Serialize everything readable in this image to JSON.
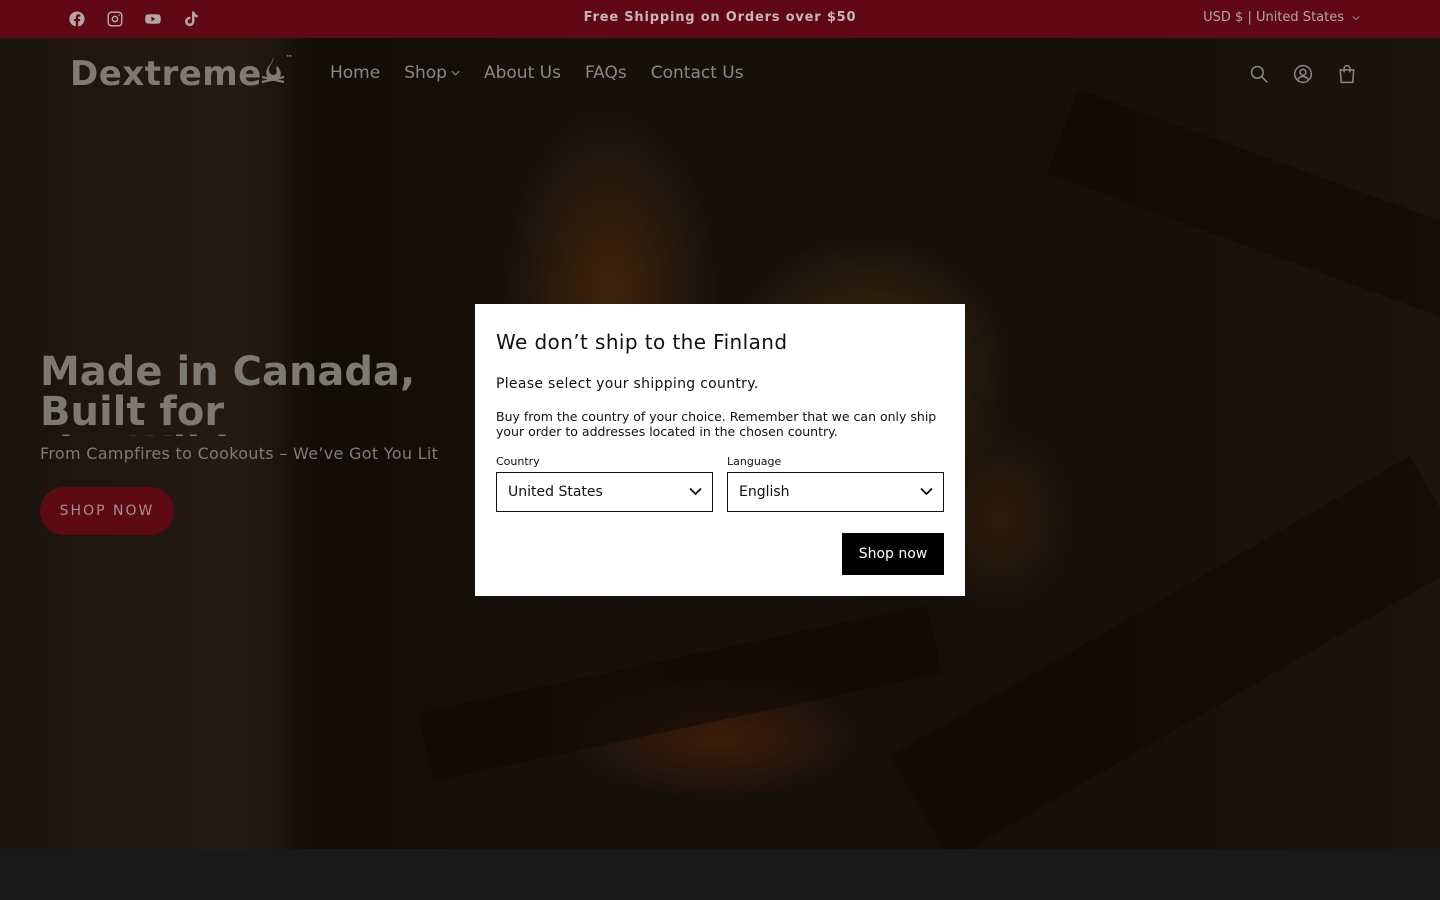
{
  "announcement": {
    "text": "Free Shipping on Orders over $50",
    "currency": "USD $ | United States",
    "social_icons": [
      "facebook-icon",
      "instagram-icon",
      "youtube-icon",
      "tiktok-icon"
    ]
  },
  "header": {
    "logo_text": "Dextreme",
    "logo_tm": "™",
    "nav": [
      "Home",
      "Shop",
      "About Us",
      "FAQs",
      "Contact Us"
    ],
    "icons": [
      "search-icon",
      "account-icon",
      "cart-icon"
    ]
  },
  "hero": {
    "title": "Made in Canada, Built for\nthe Wild",
    "subtitle": "From Campfires to Cookouts – We’ve Got You Lit",
    "button": "SHOP NOW"
  },
  "modal": {
    "title": "We don’t ship to the Finland",
    "lead": "Please select your shipping country.",
    "body": "Buy from the country of your choice. Remember that we can only ship your order to addresses located in the chosen country.",
    "country_label": "Country",
    "country_value": "United States",
    "language_label": "Language",
    "language_value": "English",
    "button": "Shop now"
  },
  "colors": {
    "announcement_bg": "#600814",
    "button_bg": "#5d0a13",
    "modal_button_bg": "#000000"
  }
}
